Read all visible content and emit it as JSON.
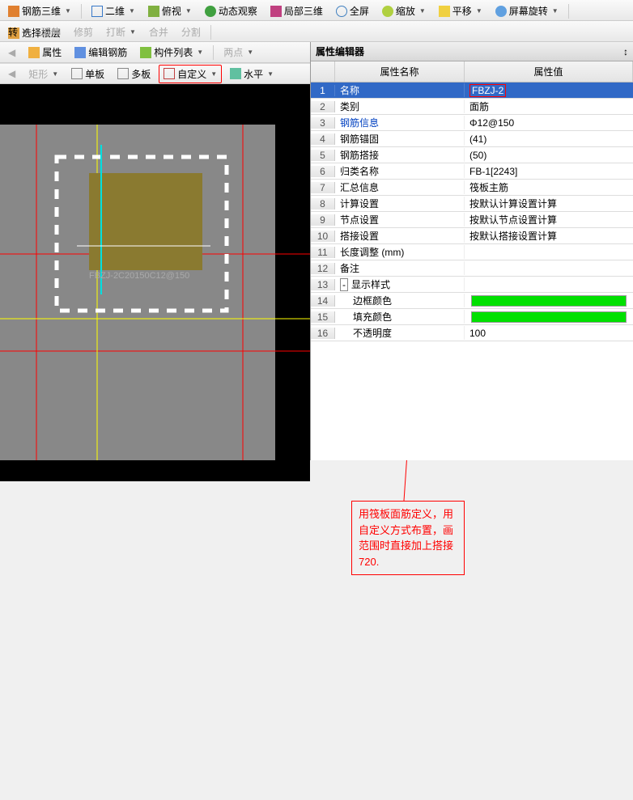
{
  "toolbar1": {
    "rebar3d": "钢筋三维",
    "view2d": "二维",
    "persp": "俯视",
    "dynobs": "动态观察",
    "local3d": "局部三维",
    "full": "全屏",
    "zoom": "缩放",
    "pan": "平移",
    "rotate": "屏幕旋转",
    "selfloor": "选择楼层"
  },
  "toolbar2": {
    "rot": "转",
    "extend": "延伸",
    "trim": "修剪",
    "break": "打断",
    "merge": "合并",
    "split": "分割"
  },
  "toolbar3": {
    "attrs": "属性",
    "editrebar": "编辑钢筋",
    "complist": "构件列表",
    "twopt": "两点"
  },
  "toolbar4": {
    "rect": "矩形",
    "single": "单板",
    "multi": "多板",
    "custom": "自定义",
    "horiz": "水平"
  },
  "propPanel": {
    "title": "属性编辑器",
    "nameCol": "属性名称",
    "valCol": "属性值",
    "rows": [
      {
        "i": "1",
        "n": "名称",
        "v": "FBZJ-2",
        "sel": true,
        "red": true
      },
      {
        "i": "2",
        "n": "类别",
        "v": "面筋"
      },
      {
        "i": "3",
        "n": "钢筋信息",
        "v": "Φ12@150",
        "blue": true
      },
      {
        "i": "4",
        "n": "钢筋锚固",
        "v": "(41)"
      },
      {
        "i": "5",
        "n": "钢筋搭接",
        "v": "(50)"
      },
      {
        "i": "6",
        "n": "归类名称",
        "v": "FB-1[2243]"
      },
      {
        "i": "7",
        "n": "汇总信息",
        "v": "筏板主筋"
      },
      {
        "i": "8",
        "n": "计算设置",
        "v": "按默认计算设置计算"
      },
      {
        "i": "9",
        "n": "节点设置",
        "v": "按默认节点设置计算"
      },
      {
        "i": "10",
        "n": "搭接设置",
        "v": "按默认搭接设置计算"
      },
      {
        "i": "11",
        "n": "长度调整 (mm)",
        "v": ""
      },
      {
        "i": "12",
        "n": "备注",
        "v": ""
      },
      {
        "i": "13",
        "n": "显示样式",
        "v": "",
        "group": true
      },
      {
        "i": "14",
        "n": "边框颜色",
        "v": "",
        "color": true
      },
      {
        "i": "15",
        "n": "填充颜色",
        "v": "",
        "color": true
      },
      {
        "i": "16",
        "n": "不透明度",
        "v": "100"
      }
    ]
  },
  "canvas": {
    "label": "FBZJ-2C20150C12@150"
  },
  "annotation": "用筏板面筋定义，用自定义方式布置，画范围时直接加上搭接720."
}
